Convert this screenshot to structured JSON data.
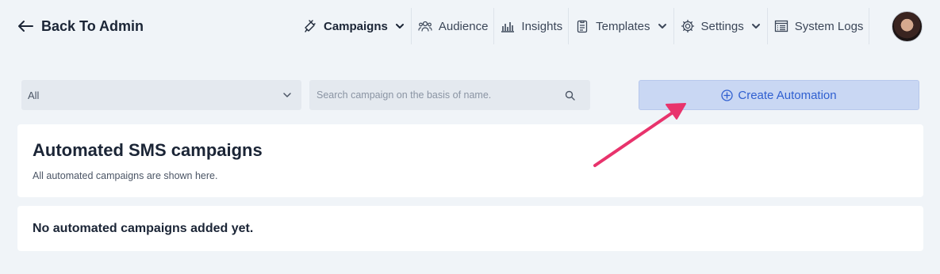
{
  "header": {
    "back_label": "Back To Admin",
    "nav": [
      {
        "label": "Campaigns",
        "icon": "megaphone-icon",
        "dropdown": true,
        "active": true
      },
      {
        "label": "Audience",
        "icon": "users-icon",
        "dropdown": false,
        "active": false
      },
      {
        "label": "Insights",
        "icon": "chart-icon",
        "dropdown": false,
        "active": false
      },
      {
        "label": "Templates",
        "icon": "clipboard-icon",
        "dropdown": true,
        "active": false
      },
      {
        "label": "Settings",
        "icon": "gear-icon",
        "dropdown": true,
        "active": false
      },
      {
        "label": "System Logs",
        "icon": "list-icon",
        "dropdown": false,
        "active": false
      }
    ]
  },
  "filters": {
    "select_value": "All",
    "search_placeholder": "Search campaign on the basis of name.",
    "create_label": "Create Automation"
  },
  "section": {
    "title": "Automated SMS campaigns",
    "subtitle": "All automated campaigns are shown here.",
    "empty_message": "No automated campaigns added yet."
  },
  "colors": {
    "accent": "#2f5fd0",
    "button_bg": "#c9d7f3",
    "annotation_arrow": "#e8336c",
    "page_bg": "#f0f4f8"
  }
}
